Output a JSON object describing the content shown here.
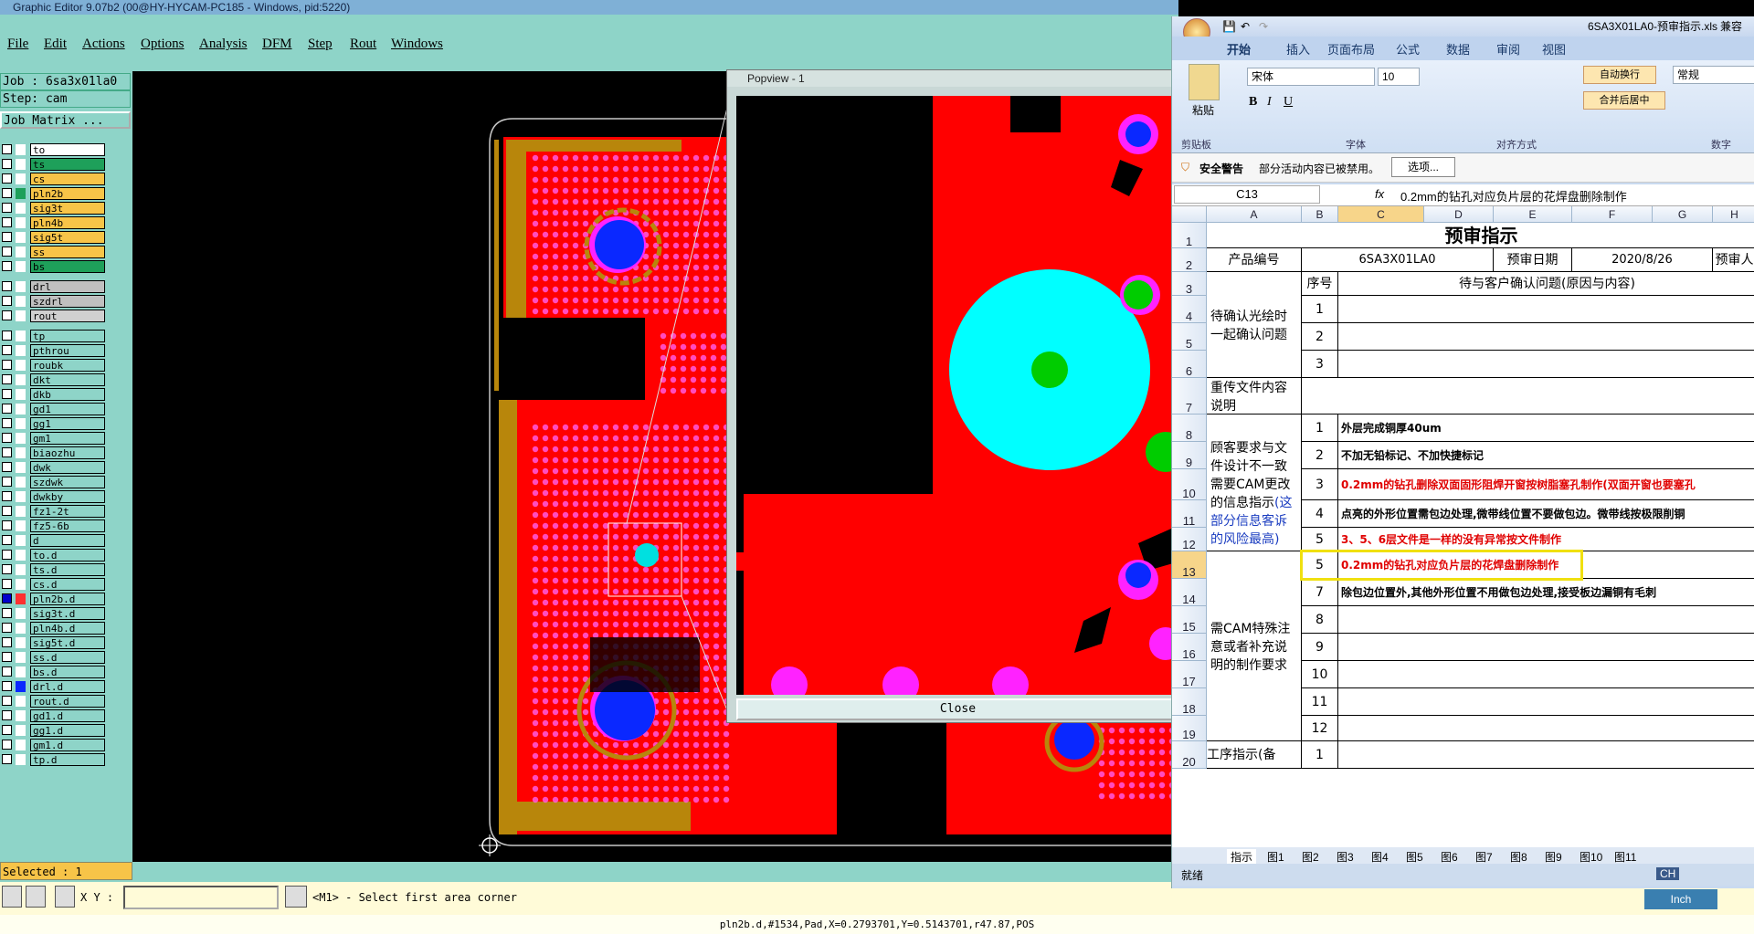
{
  "editor": {
    "title": "Graphic Editor 9.07b2 (00@HY-HYCAM-PC185 - Windows, pid:5220)",
    "menu": [
      "File",
      "Edit",
      "Actions",
      "Options",
      "Analysis",
      "DFM",
      "Step",
      "Rout",
      "Windows"
    ],
    "job": "Job : 6sa3x01la0",
    "step": "Step: cam",
    "job_matrix": "Job Matrix ...",
    "layers": [
      {
        "name": "to",
        "color": "#ffffff"
      },
      {
        "name": "ts",
        "color": "#1ea05a"
      },
      {
        "name": "cs",
        "color": "#f7c448"
      },
      {
        "name": "pln2b",
        "color": "#f7c448"
      },
      {
        "name": "sig3t",
        "color": "#f7c448"
      },
      {
        "name": "pln4b",
        "color": "#f7c448"
      },
      {
        "name": "sig5t",
        "color": "#f7c448"
      },
      {
        "name": "ss",
        "color": "#f7c448"
      },
      {
        "name": "bs",
        "color": "#1ea05a"
      },
      {
        "name": "drl",
        "color": "#c0c0c0"
      },
      {
        "name": "szdrl",
        "color": "#c0c0c0"
      },
      {
        "name": "rout",
        "color": "#d0d0d0"
      },
      {
        "name": "tp",
        "color": "#8ed4c8"
      },
      {
        "name": "pthrou",
        "color": "#8ed4c8"
      },
      {
        "name": "roubk",
        "color": "#8ed4c8"
      },
      {
        "name": "dkt",
        "color": "#8ed4c8"
      },
      {
        "name": "dkb",
        "color": "#8ed4c8"
      },
      {
        "name": "gd1",
        "color": "#8ed4c8"
      },
      {
        "name": "gg1",
        "color": "#8ed4c8"
      },
      {
        "name": "gm1",
        "color": "#8ed4c8"
      },
      {
        "name": "biaozhu",
        "color": "#8ed4c8"
      },
      {
        "name": "dwk",
        "color": "#8ed4c8"
      },
      {
        "name": "szdwk",
        "color": "#8ed4c8"
      },
      {
        "name": "dwkby",
        "color": "#8ed4c8"
      },
      {
        "name": "fz1-2t",
        "color": "#8ed4c8"
      },
      {
        "name": "fz5-6b",
        "color": "#8ed4c8"
      },
      {
        "name": "d",
        "color": "#8ed4c8"
      },
      {
        "name": "to.d",
        "color": "#8ed4c8"
      },
      {
        "name": "ts.d",
        "color": "#8ed4c8"
      },
      {
        "name": "cs.d",
        "color": "#8ed4c8"
      },
      {
        "name": "pln2b.d",
        "color": "#8ed4c8"
      },
      {
        "name": "sig3t.d",
        "color": "#8ed4c8"
      },
      {
        "name": "pln4b.d",
        "color": "#8ed4c8"
      },
      {
        "name": "sig5t.d",
        "color": "#8ed4c8"
      },
      {
        "name": "ss.d",
        "color": "#8ed4c8"
      },
      {
        "name": "bs.d",
        "color": "#8ed4c8"
      },
      {
        "name": "drl.d",
        "color": "#8ed4c8"
      },
      {
        "name": "rout.d",
        "color": "#8ed4c8"
      },
      {
        "name": "gd1.d",
        "color": "#8ed4c8"
      },
      {
        "name": "gg1.d",
        "color": "#8ed4c8"
      },
      {
        "name": "gm1.d",
        "color": "#8ed4c8"
      },
      {
        "name": "tp.d",
        "color": "#8ed4c8"
      }
    ],
    "selected": "Selected : 1",
    "xy_label": "X Y :",
    "prompt": "<M1> - Select first area corner",
    "status_line": "pln2b.d,#1534,Pad,X=0.2793701,Y=0.5143701,r47.87,POS",
    "units": "Inch"
  },
  "popview": {
    "title": "Popview - 1",
    "close": "Close"
  },
  "excel": {
    "title": "6SA3X01LA0-预审指示.xls",
    "title_suffix": "兼容",
    "tabs": [
      "开始",
      "插入",
      "页面布局",
      "公式",
      "数据",
      "审阅",
      "视图"
    ],
    "font_name": "宋体",
    "font_size": "10",
    "number_format": "常规",
    "wrap_text": "自动换行",
    "merge_center": "合并后居中",
    "paste": "粘贴",
    "group_clipboard": "剪贴板",
    "group_font": "字体",
    "group_align": "对齐方式",
    "group_number": "数字",
    "security_title": "安全警告",
    "security_msg": "部分活动内容已被禁用。",
    "options_btn": "选项...",
    "name_box": "C13",
    "fx": "fx",
    "formula": "0.2mm的钻孔对应负片层的花焊盘删除制作",
    "columns": [
      "A",
      "B",
      "C",
      "D",
      "E",
      "F",
      "G",
      "H"
    ],
    "rows": [
      "1",
      "2",
      "3",
      "4",
      "5",
      "6",
      "7",
      "8",
      "9",
      "10",
      "11",
      "12",
      "13",
      "14",
      "15",
      "16",
      "17",
      "18",
      "19",
      "20"
    ],
    "sheet_title": "预审指示",
    "r2": {
      "a": "产品编号",
      "c": "6SA3X01LA0",
      "e": "预审日期",
      "f": "2020/8/26",
      "h": "预审人"
    },
    "r3": {
      "b": "序号",
      "c": "待与客户确认问题(原因与内容)"
    },
    "a_confirm": "待确认光绘时一起确认问题",
    "nums_1_3": [
      "1",
      "2",
      "3"
    ],
    "a_reupload": "重传文件内容说明",
    "a_customer_black": "顾客要求与文件设计不一致需要CAM更改的信息指示",
    "a_customer_blue": "(这部分信息客诉的风险最高)",
    "req_rows": [
      {
        "n": "1",
        "text": "外层完成铜厚40um",
        "color": "#000"
      },
      {
        "n": "2",
        "text": "不加无铅标记、不加快捷标记",
        "color": "#000"
      },
      {
        "n": "3",
        "text": "0.2mm的钻孔删除双面固形阻焊开窗按树脂塞孔制作(双面开窗也要塞孔",
        "color": "#e00000"
      },
      {
        "n": "4",
        "text": "点亮的外形位置需包边处理,微带线位置不要做包边。微带线按极限削铜",
        "color": "#000"
      },
      {
        "n": "5",
        "text": "3、5、6层文件是一样的没有异常按文件制作",
        "color": "#e00000"
      }
    ],
    "a_special": "需CAM特殊注意或者补充说明的制作要求",
    "special_rows": [
      {
        "n": "5",
        "text": "0.2mm的钻孔对应负片层的花焊盘删除制作",
        "color": "#e00000"
      },
      {
        "n": "7",
        "text": "除包边位置外,其他外形位置不用做包边处理,接受板边漏铜有毛刺",
        "color": "#000"
      },
      {
        "n": "8",
        "text": "",
        "color": "#000"
      },
      {
        "n": "9",
        "text": "",
        "color": "#000"
      },
      {
        "n": "10",
        "text": "",
        "color": "#000"
      },
      {
        "n": "11",
        "text": "",
        "color": "#000"
      },
      {
        "n": "12",
        "text": "",
        "color": "#000"
      }
    ],
    "a_process": "工序指示(备",
    "process_n": "1",
    "sheet_tabs": [
      "指示",
      "图1",
      "图2",
      "图3",
      "图4",
      "图5",
      "图6",
      "图7",
      "图8",
      "图9",
      "图10",
      "图11"
    ],
    "status_ready": "就绪",
    "ime": "CH"
  }
}
